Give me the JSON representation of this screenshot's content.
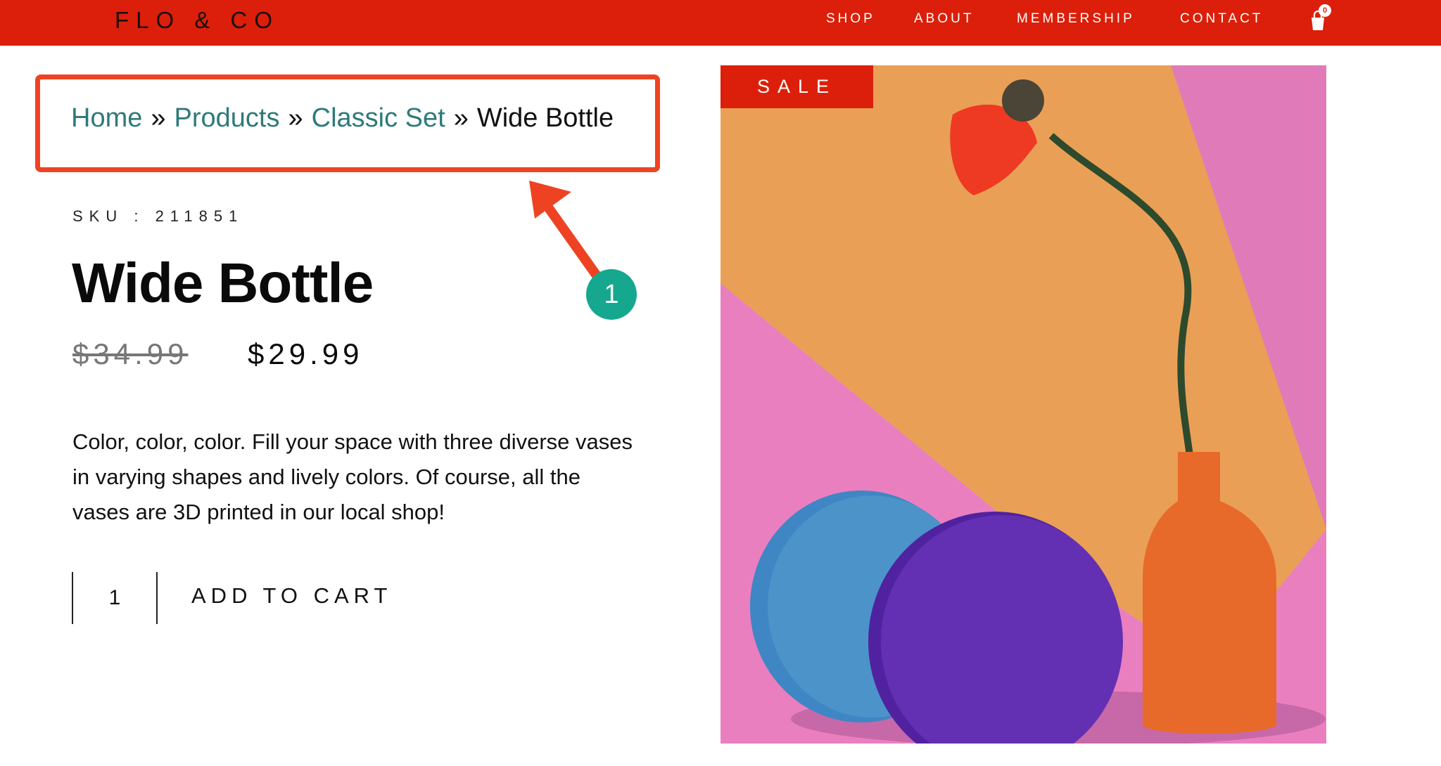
{
  "header": {
    "logo": "FLO & CO",
    "nav": [
      "SHOP",
      "ABOUT",
      "MEMBERSHIP",
      "CONTACT"
    ],
    "cart_count": "0",
    "color": "#dc1f0a"
  },
  "breadcrumb": {
    "items": [
      "Home",
      "Products",
      "Classic Set"
    ],
    "separator": "»",
    "current": "Wide Bottle"
  },
  "product": {
    "sku": "SKU : 211851",
    "title": "Wide Bottle",
    "old_price": "$34.99",
    "price": "$29.99",
    "description": "Color, color, color. Fill your space with three diverse vases in varying shapes and lively colors. Of course, all the vases are 3D printed in our local shop!",
    "quantity": "1",
    "add_to_cart": "ADD TO CART",
    "sale_badge": "SALE"
  },
  "annotation": {
    "step": "1",
    "highlight_color": "#ee4323",
    "badge_color": "#15a88f"
  }
}
